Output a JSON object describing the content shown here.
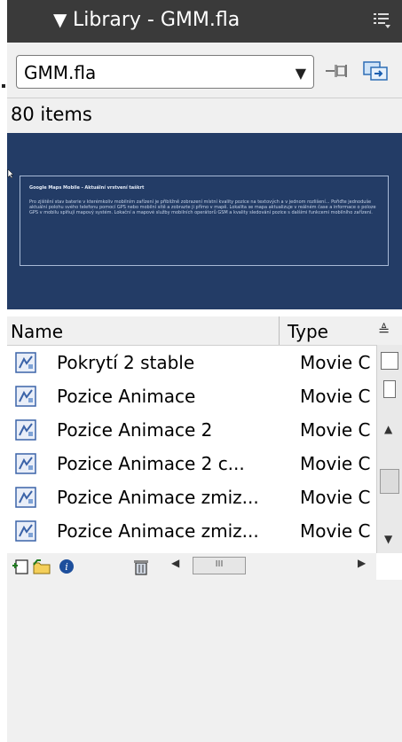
{
  "panel": {
    "title": "Library - GMM.fla",
    "collapse_icon": "triangle-down-icon",
    "options_icon": "panel-menu-icon"
  },
  "toolbar": {
    "document_select": "GMM.fla",
    "pin_icon": "pin-icon",
    "new_library_icon": "new-library-panel-icon"
  },
  "item_count": "80 items",
  "preview": {
    "title": "Google Maps Mobile - Aktuální vrstvení taškrt",
    "body": "Pro zjištění stav baterie v kterémkoliv mobilním zařízení je přibližně zobrazení místní kvality pozice na textových a v jednom rozlišení... Pořiďte jednoduše aktuální polohu svého telefonu pomocí GPS nebo mobilní sítě a zobrazte ji přímo v mapě. Lokalita se mapa aktualizuje v reálném čase a informace o poloze GPS v mobilu splňují mapový systém. Lokační a mapové služby mobilních operátorů GSM a kvality sledování pozice s dalšími funkcemi mobilního zařízení."
  },
  "columns": {
    "name": "Name",
    "type": "Type"
  },
  "items": [
    {
      "name": "Pokrytí 2 stable",
      "type": "Movie C",
      "icon": "movie-clip-icon"
    },
    {
      "name": "Pozice Animace",
      "type": "Movie C",
      "icon": "movie-clip-icon"
    },
    {
      "name": "Pozice Animace 2",
      "type": "Movie C",
      "icon": "movie-clip-icon"
    },
    {
      "name": "Pozice Animace 2 c...",
      "type": "Movie C",
      "icon": "movie-clip-icon"
    },
    {
      "name": "Pozice Animace zmiz...",
      "type": "Movie C",
      "icon": "movie-clip-icon"
    },
    {
      "name": "Pozice Animace zmiz...",
      "type": "Movie C",
      "icon": "movie-clip-icon"
    }
  ],
  "bottom_bar": {
    "icons": [
      "new-symbol-icon",
      "new-folder-icon",
      "properties-icon",
      "delete-icon"
    ],
    "scroll_label": "III"
  },
  "colors": {
    "titlebar": "#3a3a3a",
    "preview_bg": "#233c66",
    "panel_bg": "#f0f0f0"
  }
}
